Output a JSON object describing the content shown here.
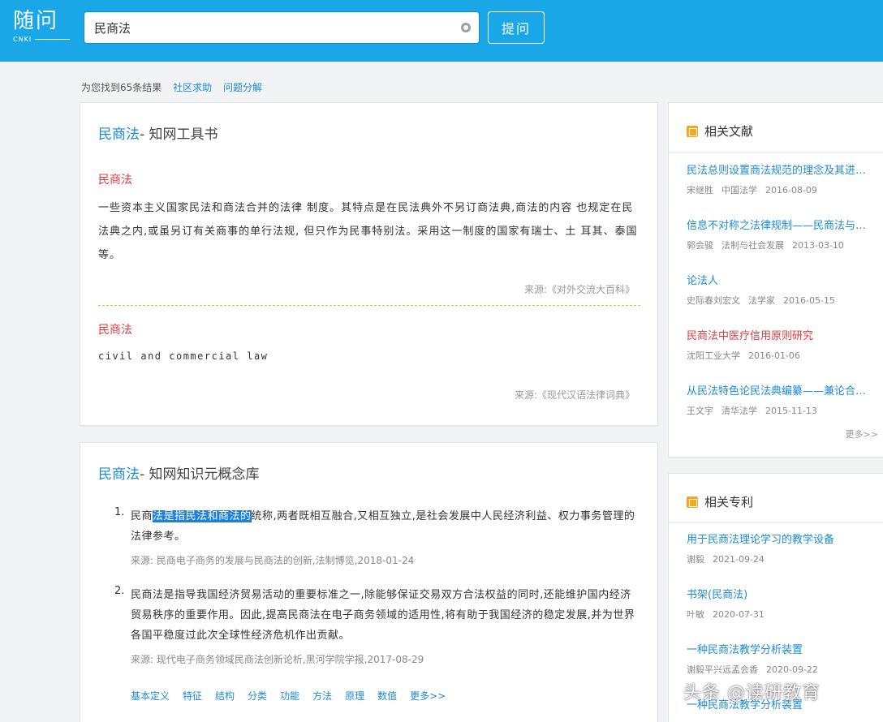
{
  "header": {
    "logo": "随问",
    "logo_sub": "CNKI",
    "search_value": "民商法",
    "ask_label": "提问"
  },
  "results": {
    "count_text": "为您找到65条结果",
    "link1": "社区求助",
    "link2": "问题分解"
  },
  "card1": {
    "term": "民商法",
    "title_suffix": "- 知网工具书",
    "entry1_term": "民商法",
    "entry1_text": "一些资本主义国家民法和商法合并的法律 制度。其特点是在民法典外不另订商法典,商法的内容 也规定在民法典之内,或虽另订有关商事的单行法规, 但只作为民事特别法。采用这一制度的国家有瑞士、土 耳其、泰国等。",
    "entry1_source": "来源:《对外交流大百科》",
    "entry2_term": "民商法",
    "entry2_text": "civil and commercial law",
    "entry2_source": "来源:《现代汉语法律词典》"
  },
  "card2": {
    "term": "民商法",
    "title_suffix": "- 知网知识元概念库",
    "items": [
      {
        "num": "1.",
        "pre": "民商",
        "highlight": "法是指民法和商法的",
        "post": "统称,两者既相互融合,又相互独立,是社会发展中人民经济利益、权力事务管理的法律参考。",
        "source": "来源: 民商电子商务的发展与民商法的创新,法制博览,2018-01-24"
      },
      {
        "num": "2.",
        "text": "民商法是指导我国经济贸易活动的重要标准之一,除能够保证交易双方合法权益的同时,还能维护国内经济贸易秩序的重要作用。因此,提高民商法在电子商务领域的适用性,将有助于我国经济的稳定发展,并为世界各国平稳度过此次全球性经济危机作出贡献。",
        "source": "来源: 现代电子商务领域民商法创新论析,黑河学院学报,2017-08-29"
      }
    ],
    "links": [
      "基本定义",
      "特征",
      "结构",
      "分类",
      "功能",
      "方法",
      "原理",
      "数值",
      "更多>>"
    ]
  },
  "sidebar": {
    "docs_title": "相关文献",
    "docs": [
      {
        "title_pre": "民法总则设置商法规范的理念及其进…",
        "author": "宋继胜",
        "venue": "中国法学",
        "date": "2016-08-09"
      },
      {
        "title_pre": "信息不对称之法律规制——民商法与…",
        "author": "郭会骏",
        "venue": "法制与社会发展",
        "date": "2013-03-10"
      },
      {
        "title_pre": "论法人",
        "author": "史际春刘宏文",
        "venue": "法学家",
        "date": "2016-05-15"
      },
      {
        "title_pre": "民商法中医疗信用原则研究",
        "author": "",
        "venue": "沈阳工业大学",
        "date": "2016-01-06"
      },
      {
        "title_pre": "从民法特色论民法典编纂——兼论合…",
        "author": "王文宇",
        "venue": "清华法学",
        "date": "2015-11-13"
      }
    ],
    "more": "更多>>",
    "patents_title": "相关专利",
    "patents": [
      {
        "title": "用于民商法理论学习的教学设备",
        "author": "谢毅",
        "date": "2021-09-24"
      },
      {
        "title": "书架(民商法)",
        "author": "叶敏",
        "date": "2020-07-31"
      },
      {
        "title": "一种民商法教学分析装置",
        "author": "谢毅平兴远孟会香",
        "date": "2020-09-22"
      },
      {
        "title": "一种民商法教学分析装置",
        "author": "",
        "date": ""
      }
    ]
  },
  "watermark": "头条 @读研教育"
}
